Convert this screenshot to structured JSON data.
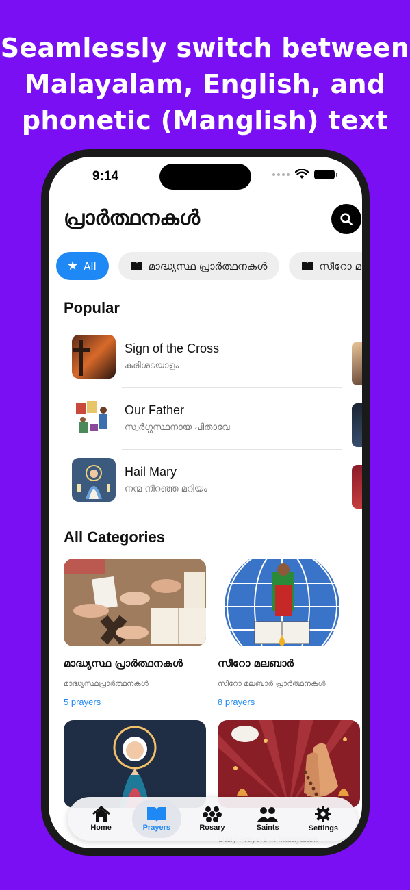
{
  "promo": {
    "line1": "Seamlessly switch between",
    "line2": "Malayalam, English, and",
    "line3": "phonetic (Manglish) text"
  },
  "status": {
    "time": "9:14"
  },
  "page": {
    "title": "പ്രാർത്ഥനകൾ"
  },
  "chips": [
    {
      "label": "All",
      "icon": "star-icon"
    },
    {
      "label": "മാദ്ധ്യസ്ഥ പ്രാർത്ഥനകൾ",
      "icon": "book-icon"
    },
    {
      "label": "സീറോ മലബ",
      "icon": "book-icon"
    }
  ],
  "popular": {
    "title": "Popular",
    "items": [
      {
        "title": "Sign of the Cross",
        "subtitle": "കുരിശടയാളം"
      },
      {
        "title": "Our Father",
        "subtitle": "സ്വർഗ്ഗസ്ഥനായ പിതാവേ"
      },
      {
        "title": "Hail Mary",
        "subtitle": "നന്മ നിറഞ്ഞ മറിയം"
      }
    ]
  },
  "categories": {
    "title": "All Categories",
    "items": [
      {
        "title": "മാദ്ധ്യസ്ഥ പ്രാർത്ഥനകൾ",
        "subtitle": "മാദ്ധ്യസ്ഥപ്രാർത്ഥനകൾ",
        "count": "5 prayers"
      },
      {
        "title": "സീറോ മലബാർ",
        "subtitle": "സീറോ മലബാർ പ്രാർത്ഥനകൾ",
        "count": "8 prayers"
      }
    ],
    "peek_subtitle": "Daily Prayers in Malayalam"
  },
  "tabs": [
    {
      "label": "Home",
      "icon": "home-icon"
    },
    {
      "label": "Prayers",
      "icon": "book-icon"
    },
    {
      "label": "Rosary",
      "icon": "rosary-icon"
    },
    {
      "label": "Saints",
      "icon": "people-icon"
    },
    {
      "label": "Settings",
      "icon": "gear-icon"
    }
  ],
  "colors": {
    "background": "#7a0ff3",
    "accent": "#1e88f5"
  }
}
